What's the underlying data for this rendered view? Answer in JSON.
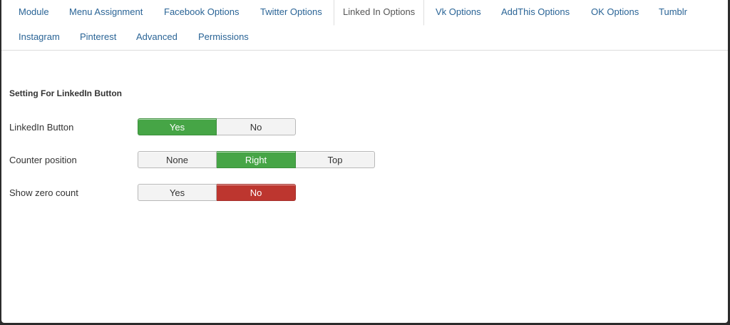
{
  "tabs": [
    {
      "label": "Module"
    },
    {
      "label": "Menu Assignment"
    },
    {
      "label": "Facebook Options"
    },
    {
      "label": "Twitter Options"
    },
    {
      "label": "Linked In Options"
    },
    {
      "label": "Vk Options"
    },
    {
      "label": "AddThis Options"
    },
    {
      "label": "OK Options"
    },
    {
      "label": "Tumblr"
    },
    {
      "label": "Instagram"
    },
    {
      "label": "Pinterest"
    },
    {
      "label": "Advanced"
    },
    {
      "label": "Permissions"
    }
  ],
  "active_tab": "Linked In Options",
  "section_title": "Setting For LinkedIn Button",
  "settings": [
    {
      "label": "LinkedIn Button",
      "options": [
        "Yes",
        "No"
      ],
      "selected": "Yes",
      "selected_color": "green"
    },
    {
      "label": "Counter position",
      "options": [
        "None",
        "Right",
        "Top"
      ],
      "selected": "Right",
      "selected_color": "green"
    },
    {
      "label": "Show zero count",
      "options": [
        "Yes",
        "No"
      ],
      "selected": "No",
      "selected_color": "red"
    }
  ],
  "colors": {
    "tab_link": "#2a6496",
    "green": "#46a546",
    "red": "#bd362f",
    "frame_background": "#2b2b2b"
  }
}
